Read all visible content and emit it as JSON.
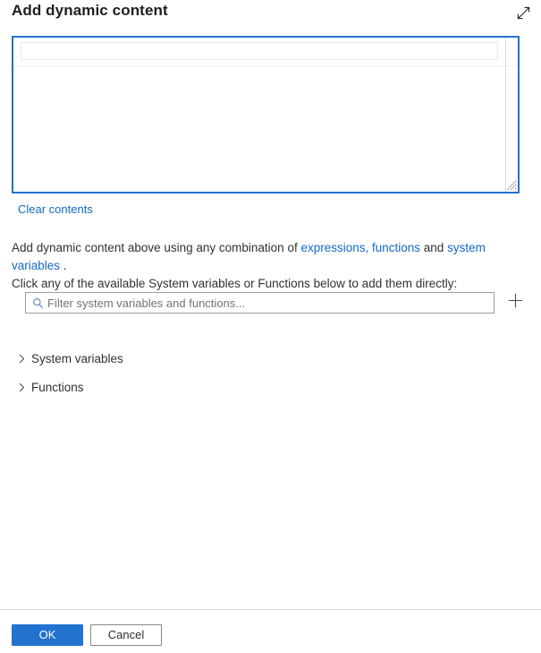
{
  "panel": {
    "title": "Add dynamic content",
    "expand_icon": "expand-diagonal-icon"
  },
  "editor": {
    "value": "",
    "placeholder": "",
    "clear_label": "Clear contents",
    "resize_grip_icon": "resize-grip-icon"
  },
  "description": {
    "line1_prefix": "Add dynamic content above using any combination of ",
    "link_expressions": "expressions, functions",
    "line1_middle": " and ",
    "link_system_variables": "system variables",
    "line1_suffix": " .",
    "line2": "Click any of the available System variables or Functions below to add them directly:"
  },
  "filter": {
    "placeholder": "Filter system variables and functions...",
    "value": "",
    "search_icon": "search-icon",
    "add_icon": "plus-icon"
  },
  "tree": {
    "items": [
      {
        "label": "System variables",
        "expanded": false,
        "chevron": "chevron-right-icon"
      },
      {
        "label": "Functions",
        "expanded": false,
        "chevron": "chevron-right-icon"
      }
    ]
  },
  "footer": {
    "ok_label": "OK",
    "cancel_label": "Cancel"
  },
  "colors": {
    "accent": "#2272cf",
    "link": "#1269c9",
    "text": "#323130",
    "border": "#a19f9d",
    "divider": "#e1dfdd"
  }
}
